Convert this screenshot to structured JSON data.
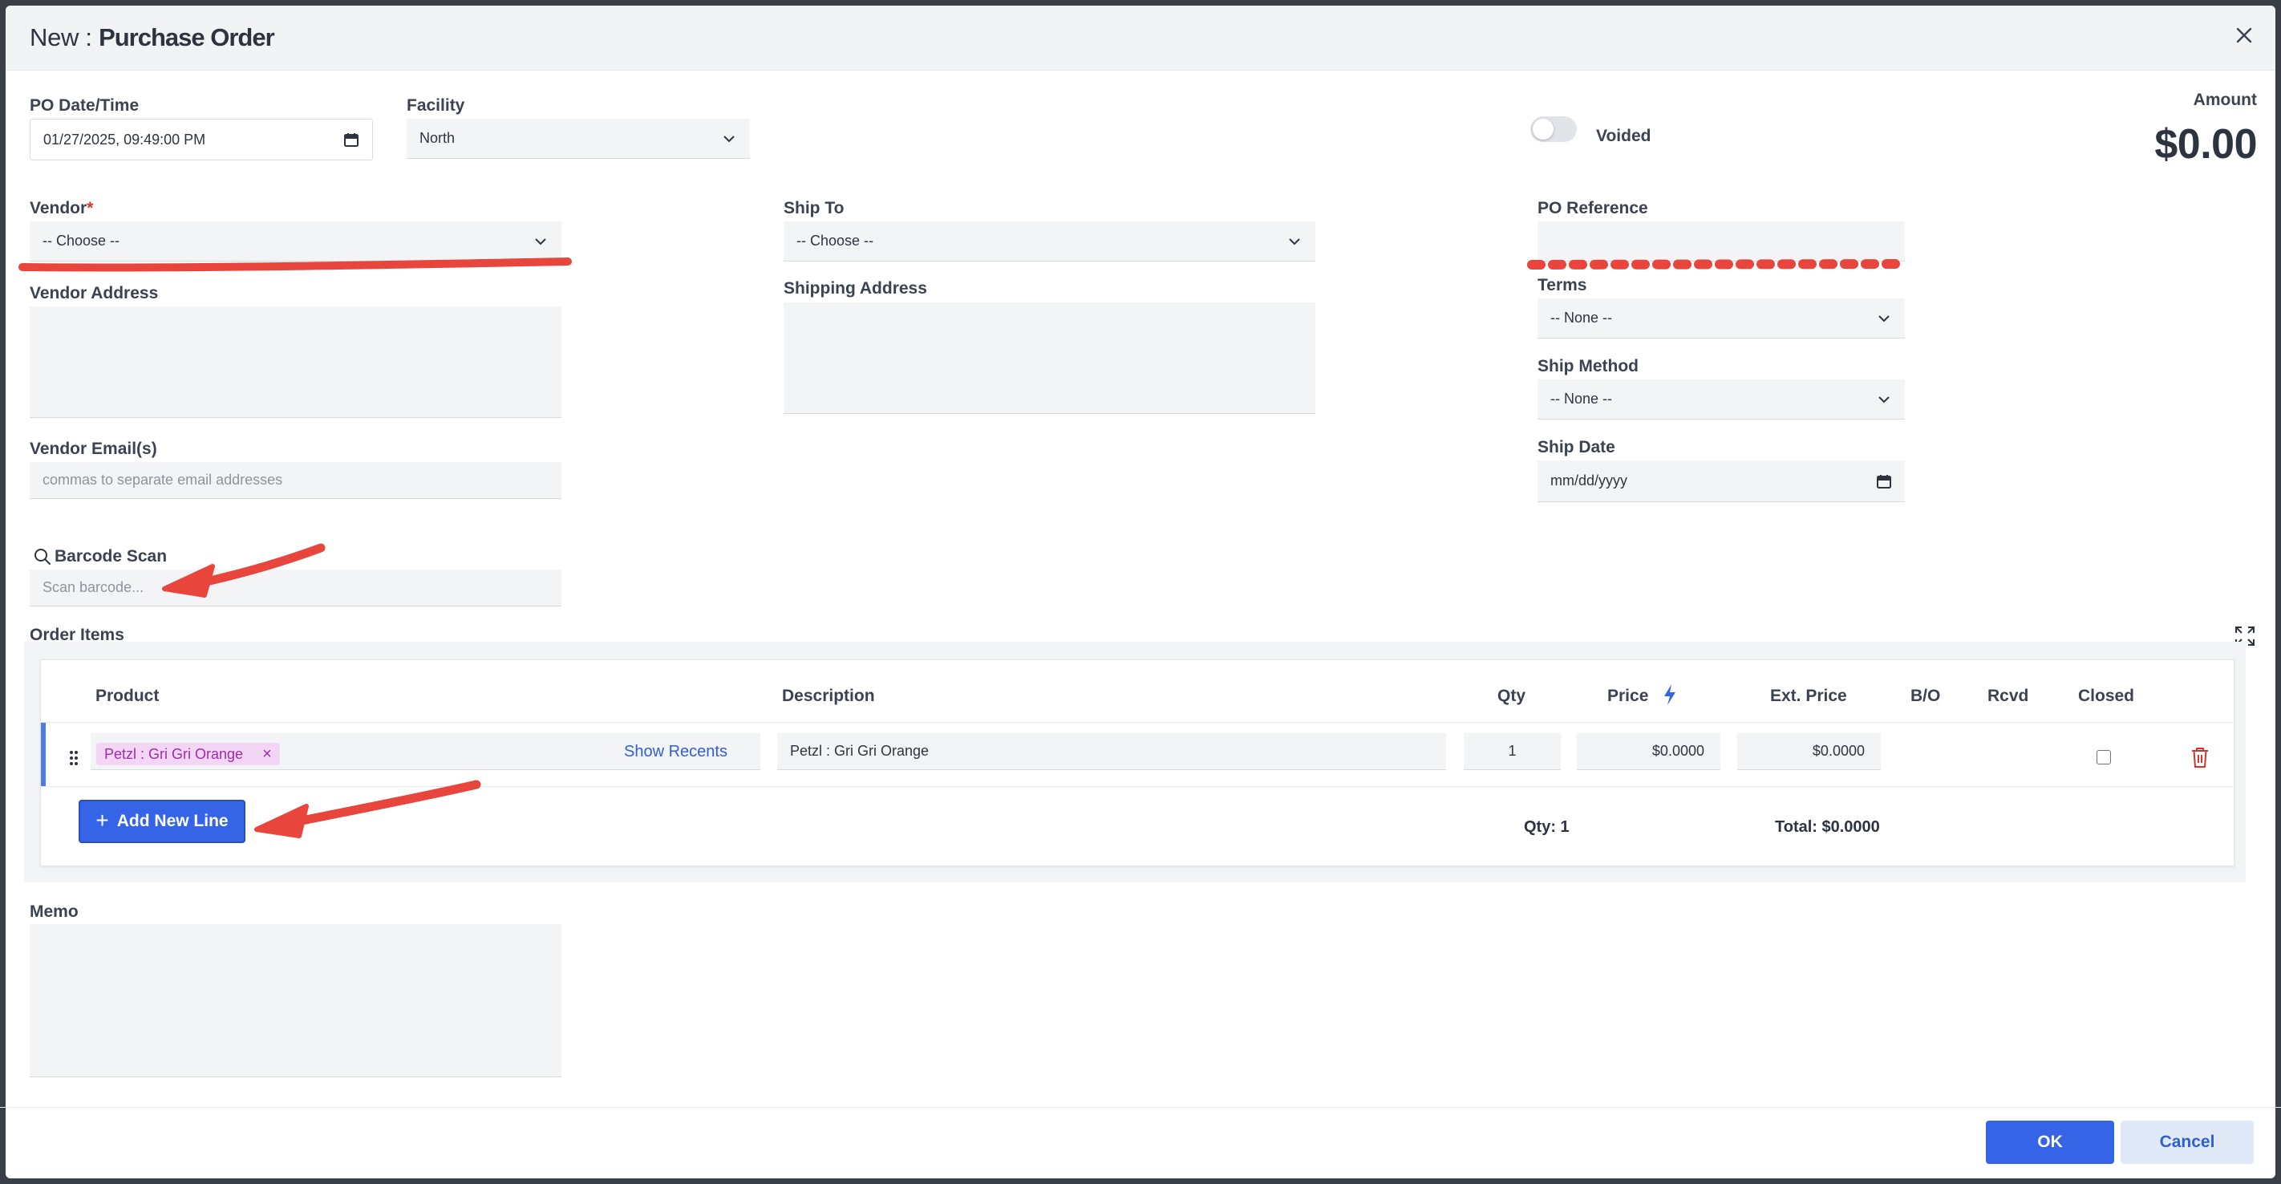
{
  "header": {
    "prefix": "New : ",
    "title": "Purchase Order"
  },
  "form": {
    "po_datetime": {
      "label": "PO Date/Time",
      "value": "01/27/2025, 09:49:00 PM"
    },
    "facility": {
      "label": "Facility",
      "value": "North"
    },
    "voided": {
      "label": "Voided",
      "checked": false
    },
    "amount": {
      "label": "Amount",
      "value": "$0.00"
    },
    "vendor": {
      "label": "Vendor",
      "required_mark": "*",
      "value": "-- Choose --"
    },
    "ship_to": {
      "label": "Ship To",
      "value": "-- Choose --"
    },
    "po_reference": {
      "label": "PO Reference",
      "value": ""
    },
    "vendor_address": {
      "label": "Vendor Address"
    },
    "shipping_address": {
      "label": "Shipping Address"
    },
    "terms": {
      "label": "Terms",
      "value": "-- None --"
    },
    "ship_method": {
      "label": "Ship Method",
      "value": "-- None --"
    },
    "ship_date": {
      "label": "Ship Date",
      "value": "mm/dd/yyyy"
    },
    "vendor_emails": {
      "label": "Vendor Email(s)",
      "placeholder": "commas to separate email addresses"
    },
    "barcode_scan": {
      "label": "Barcode Scan",
      "placeholder": "Scan barcode..."
    },
    "memo": {
      "label": "Memo"
    }
  },
  "order_items": {
    "label": "Order Items",
    "columns": {
      "product": "Product",
      "description": "Description",
      "qty": "Qty",
      "price": "Price",
      "ext_price": "Ext. Price",
      "bo": "B/O",
      "rcvd": "Rcvd",
      "closed": "Closed"
    },
    "rows": [
      {
        "product": "Petzl : Gri Gri Orange",
        "show_recents": "Show Recents",
        "description": "Petzl : Gri Gri Orange",
        "qty": "1",
        "price": "$0.0000",
        "ext_price": "$0.0000",
        "closed": false
      }
    ],
    "add_line_label": "Add New Line",
    "total_qty": "Qty: 1",
    "total": "Total: $0.0000"
  },
  "footer": {
    "ok": "OK",
    "cancel": "Cancel"
  },
  "colors": {
    "primary": "#3564e6",
    "annotation": "#e8453c",
    "tag_bg": "#f3d5f5",
    "tag_text": "#9b2fa6",
    "delete": "#d6332b"
  }
}
